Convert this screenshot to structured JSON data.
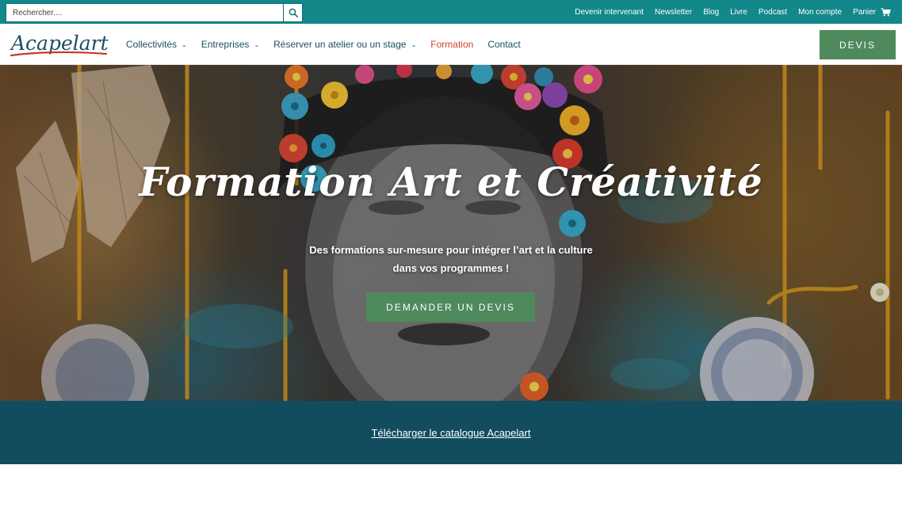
{
  "topbar": {
    "search": {
      "placeholder": "Rechercher...."
    },
    "links": [
      {
        "label": "Devenir intervenant"
      },
      {
        "label": "Newsletter"
      },
      {
        "label": "Blog"
      },
      {
        "label": "Livre"
      },
      {
        "label": "Podcast"
      },
      {
        "label": "Mon compte"
      },
      {
        "label": "Panier"
      }
    ]
  },
  "header": {
    "logo_text": "Acapelart",
    "nav": [
      {
        "label": "Collectivités",
        "has_dropdown": true
      },
      {
        "label": "Entreprises",
        "has_dropdown": true
      },
      {
        "label": "Réserver un atelier ou un stage",
        "has_dropdown": true
      },
      {
        "label": "Formation",
        "active": true
      },
      {
        "label": "Contact"
      }
    ],
    "devis_label": "DEVIS"
  },
  "hero": {
    "title": "Formation Art et Créativité",
    "subtitle": "Des formations sur-mesure pour intégrer l’art et la culture dans vos programmes !",
    "cta_label": "DEMANDER UN DEVIS"
  },
  "band": {
    "link_label": "Télécharger le catalogue Acapelart"
  },
  "colors": {
    "topbar": "#12888a",
    "nav_text": "#1d4e63",
    "nav_active": "#d0452a",
    "button_green": "#4f8a5c",
    "band": "#114d5f"
  }
}
